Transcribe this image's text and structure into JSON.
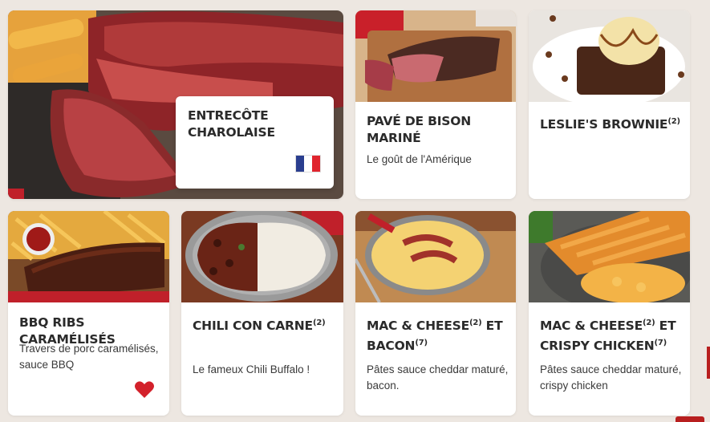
{
  "colors": {
    "background": "#ede7e1",
    "card": "#ffffff",
    "title_text": "#2b2b2b",
    "accent_red": "#c0202a",
    "flag_blue": "#2a3e8f",
    "flag_red": "#e0242e"
  },
  "hero": {
    "title_line1": "ENTRECÔTE",
    "title_line2": "CHAROLAISE",
    "flag_icon": "french-flag-icon"
  },
  "cards": [
    {
      "title": "PAVÉ DE BISON MARINÉ",
      "sup": "",
      "title2": "",
      "sup2": "",
      "desc_line1": "Le goût de l'Amérique",
      "desc_line2": ""
    },
    {
      "title": "LESLIE'S BROWNIE",
      "sup": "(2)",
      "title2": "",
      "sup2": "",
      "desc_line1": "",
      "desc_line2": ""
    },
    {
      "title": "BBQ RIBS CARAMÉLISÉS",
      "sup": "",
      "title2": "",
      "sup2": "",
      "desc_line1": "Travers de porc caramélisés,",
      "desc_line2": "sauce BBQ",
      "icon": "heart-icon"
    },
    {
      "title": "CHILI CON CARNE",
      "sup": "(2)",
      "title2": "",
      "sup2": "",
      "desc_line1": "Le fameux Chili Buffalo !",
      "desc_line2": ""
    },
    {
      "title": "MAC & CHEESE",
      "sup": "(2)",
      "title_mid": " ET",
      "title2": "BACON",
      "sup2": "(7)",
      "desc_line1": "Pâtes sauce cheddar maturé,",
      "desc_line2": "bacon."
    },
    {
      "title": "MAC & CHEESE",
      "sup": "(2)",
      "title_mid": " ET",
      "title2": "CRISPY CHICKEN",
      "sup2": "(7)",
      "desc_line1": "Pâtes sauce cheddar maturé,",
      "desc_line2": "crispy chicken"
    }
  ]
}
